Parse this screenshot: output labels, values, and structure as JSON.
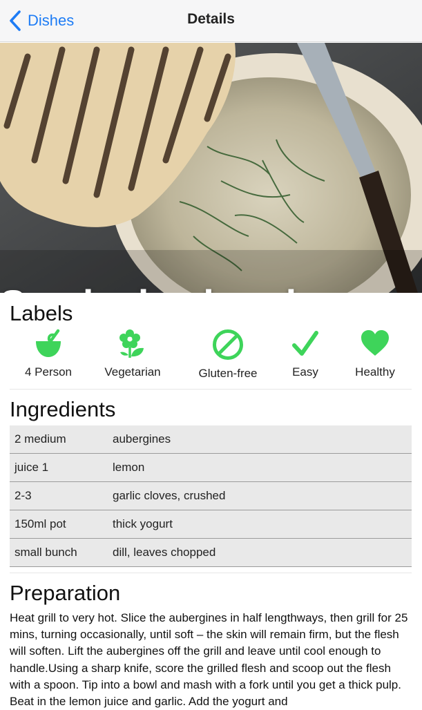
{
  "navbar": {
    "back_label": "Dishes",
    "title": "Details"
  },
  "hero": {
    "title": "Smoked aubergine"
  },
  "labels": {
    "heading": "Labels",
    "items": [
      {
        "label": "4 Person",
        "icon": "bowl-icon"
      },
      {
        "label": "Vegetarian",
        "icon": "flower-icon"
      },
      {
        "label": "Gluten-free",
        "icon": "no-sign-icon"
      },
      {
        "label": "Easy",
        "icon": "checkmark-icon"
      },
      {
        "label": "Healthy",
        "icon": "heart-icon"
      }
    ],
    "color": "#3ed45a"
  },
  "ingredients": {
    "heading": "Ingredients",
    "rows": [
      {
        "qty": "2 medium",
        "name": "aubergines"
      },
      {
        "qty": "juice 1",
        "name": "lemon"
      },
      {
        "qty": "2-3",
        "name": "garlic cloves, crushed"
      },
      {
        "qty": "150ml pot",
        "name": "thick yogurt"
      },
      {
        "qty": "small bunch",
        "name": "dill, leaves chopped"
      }
    ]
  },
  "preparation": {
    "heading": "Preparation",
    "text": "Heat grill to very hot. Slice the aubergines in half lengthways, then grill for 25 mins, turning occasionally, until soft – the skin will remain firm, but the flesh will soften. Lift the aubergines off the grill and leave until cool enough to handle.Using a sharp knife, score the grilled flesh and scoop out the flesh with a spoon. Tip into a bowl and mash with a fork until you get a thick pulp. Beat in the lemon juice and garlic. Add the yogurt and"
  }
}
